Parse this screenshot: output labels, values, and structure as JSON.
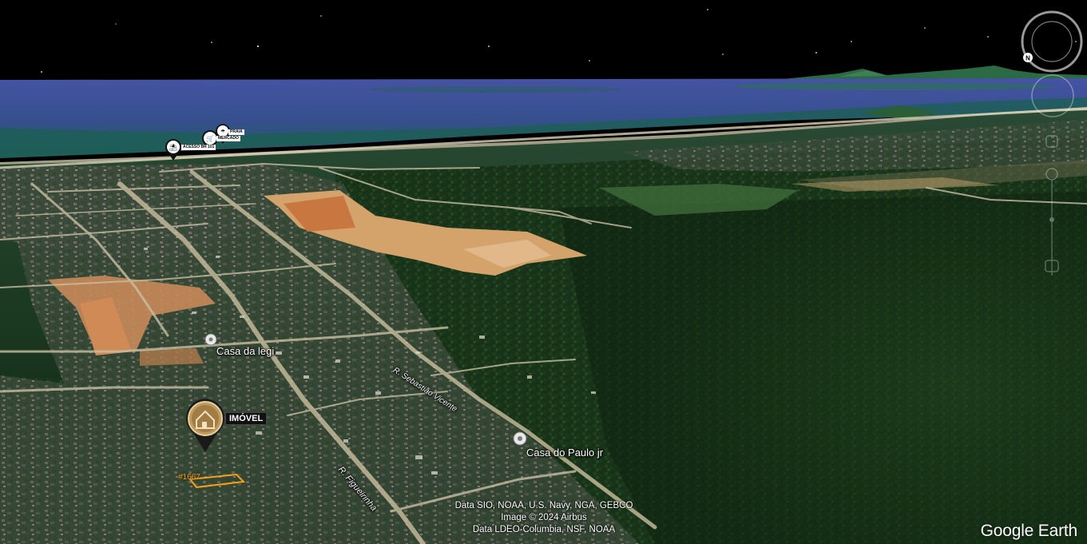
{
  "places": [
    {
      "id": "casa-da-legi",
      "name": "Casa da legi"
    },
    {
      "id": "casa-do-paulo",
      "name": "Casa do Paulo jr"
    }
  ],
  "roads": [
    {
      "id": "road-upper",
      "name": "R. Sebastião Vicente"
    },
    {
      "id": "road-lower",
      "name": "R. Figueirinha"
    }
  ],
  "property_marker": {
    "label": "IMÓVEL",
    "parcel_id": "#1667",
    "icon": "house-pin-icon"
  },
  "poi_markers": [
    {
      "icon": "beach-access-icon",
      "label": "ACESSO BR 101"
    },
    {
      "icon": "market-cart-icon",
      "label": "MERCADO"
    },
    {
      "icon": "beach-icon",
      "label": "PRAIA"
    }
  ],
  "attribution": {
    "line1": "Data SIO, NOAA, U.S. Navy, NGA, GEBCO",
    "line2": "Image © 2024 Airbus",
    "line3": "Data LDEO-Columbia, NSF, NOAA"
  },
  "brand": {
    "google": "Google",
    "earth": "Earth"
  },
  "colors": {
    "sky": "#000000",
    "sea": "#3f4f97",
    "forest": "#1c3a1d",
    "parcel_outline": "#f7a21b"
  },
  "controls": {
    "compass": "compass-icon",
    "north": "N"
  }
}
